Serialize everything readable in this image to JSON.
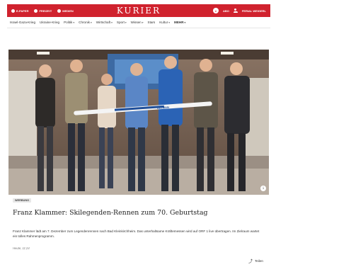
{
  "topbar": {
    "links": [
      {
        "label": "E-PAPER",
        "icon": "newspaper-icon"
      },
      {
        "label": "FREIZEIT",
        "icon": "leaf-icon"
      },
      {
        "label": "MEDIEN",
        "icon": "play-icon"
      }
    ],
    "logo": "KURIER",
    "account_short": "ABO",
    "login_label": "FERIAL WEIGERL",
    "colors": {
      "brand": "#d0222e"
    }
  },
  "nav": {
    "items": [
      {
        "label": "Israel-Gaza-Krieg",
        "chevron": false
      },
      {
        "label": "Ukraine-Krieg",
        "chevron": false
      },
      {
        "label": "Politik",
        "chevron": true
      },
      {
        "label": "Chronik",
        "chevron": true
      },
      {
        "label": "Wirtschaft",
        "chevron": true
      },
      {
        "label": "Sport",
        "chevron": true
      },
      {
        "label": "Wissen",
        "chevron": true
      },
      {
        "label": "Stars",
        "chevron": false
      },
      {
        "label": "Kultur",
        "chevron": true
      },
      {
        "label": "MEHR",
        "chevron": true
      }
    ]
  },
  "article": {
    "badge": "WERBUNG",
    "headline": "Franz Klammer: Skilegenden-Rennen zum 70. Geburtstag",
    "lead": "Franz Klammer lädt am 7. Dezember zum Legendenrennen nach Bad Kleinkirchheim. Das unterhaltsame Kräftemessen wird auf ORF 1 live übertragen. Im Zielraum wartet ein tolles Rahmenprogramm.",
    "timestamp": "Heute, 11:24",
    "share_label": "Teilen",
    "photo_ski_text": "ULLMAN"
  }
}
